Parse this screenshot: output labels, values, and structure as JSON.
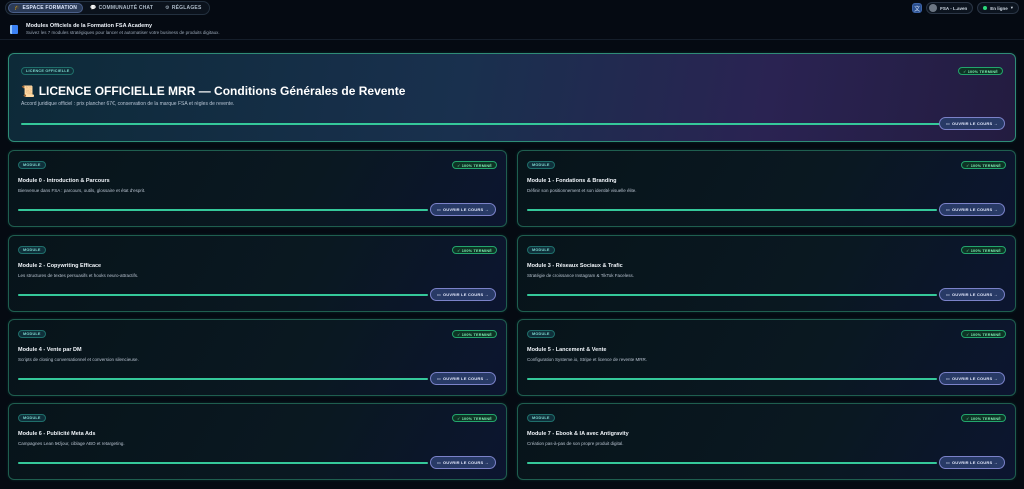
{
  "nav": {
    "tabs": [
      {
        "label": "ESPACE FORMATION",
        "icon": "graduation-icon",
        "active": true
      },
      {
        "label": "COMMUNAUTÉ CHAT",
        "icon": "chat-icon",
        "active": false
      },
      {
        "label": "RÉGLAGES",
        "icon": "gear-icon",
        "active": false
      }
    ],
    "user_label": "FSA - L.aven",
    "status_label": "En ligne"
  },
  "header": {
    "title": "Modules Officiels de la Formation FSA Academy",
    "subtitle": "Suivez les 7 modules stratégiques pour lancer et automatiser votre business de produits digitaux."
  },
  "hero": {
    "kind_badge": "LICENCE OFFICIELLE",
    "done_badge": "✓ 100% TERMINÉ",
    "title": "LICENCE OFFICIELLE MRR — Conditions Générales de Revente",
    "description": "Accord juridique officiel : prix plancher 67€, conservation de la marque FSA et règles de revente.",
    "progress": 1.0,
    "button_label": "OUVRIR LE COURS →"
  },
  "modules": [
    {
      "kind": "MODULE",
      "done": "✓ 100% TERMINÉ",
      "title": "Module 0 - Introduction & Parcours",
      "description": "Bienvenue dans FSA : parcours, outils, glossaire et état d'esprit.",
      "progress": 1.0,
      "button": "OUVRIR LE COURS →"
    },
    {
      "kind": "MODULE",
      "done": "✓ 100% TERMINÉ",
      "title": "Module 1 - Fondations & Branding",
      "description": "Définir son positionnement et son identité visuelle élite.",
      "progress": 1.0,
      "button": "OUVRIR LE COURS →"
    },
    {
      "kind": "MODULE",
      "done": "✓ 100% TERMINÉ",
      "title": "Module 2 - Copywriting Efficace",
      "description": "Les structures de textes persuasifs et hooks neuro-attractifs.",
      "progress": 1.0,
      "button": "OUVRIR LE COURS →"
    },
    {
      "kind": "MODULE",
      "done": "✓ 100% TERMINÉ",
      "title": "Module 3 - Réseaux Sociaux & Trafic",
      "description": "Stratégie de croissance Instagram & TikTok Faceless.",
      "progress": 1.0,
      "button": "OUVRIR LE COURS →"
    },
    {
      "kind": "MODULE",
      "done": "✓ 100% TERMINÉ",
      "title": "Module 4 - Vente par DM",
      "description": "Scripts de closing conversationnel et conversion silencieuse.",
      "progress": 1.0,
      "button": "OUVRIR LE COURS →"
    },
    {
      "kind": "MODULE",
      "done": "✓ 100% TERMINÉ",
      "title": "Module 5 - Lancement & Vente",
      "description": "Configuration Systeme.io, Stripe et licence de revente MRR.",
      "progress": 1.0,
      "button": "OUVRIR LE COURS →"
    },
    {
      "kind": "MODULE",
      "done": "✓ 100% TERMINÉ",
      "title": "Module 6 - Publicité Meta Ads",
      "description": "Campagnes Lean 5€/jour, ciblage ABO et retargeting.",
      "progress": 1.0,
      "button": "OUVRIR LE COURS →"
    },
    {
      "kind": "MODULE",
      "done": "✓ 100% TERMINÉ",
      "title": "Module 7 - Ebook & IA avec Antigravity",
      "description": "Création pas-à-pas de son propre produit digital.",
      "progress": 1.0,
      "button": "OUVRIR LE COURS →"
    }
  ],
  "colors": {
    "accent_green": "#35c89a",
    "button_bg": "#283a66",
    "card_border": "#1f5e4f"
  }
}
